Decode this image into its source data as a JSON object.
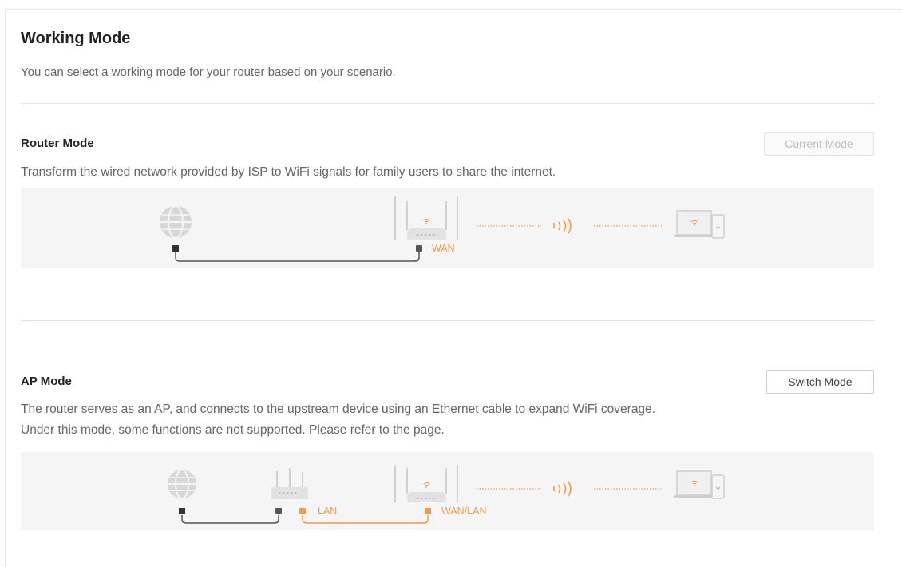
{
  "page": {
    "title": "Working Mode",
    "subtitle": "You can select a working mode for your router based on your scenario."
  },
  "router_mode": {
    "title": "Router Mode",
    "button_label": "Current Mode",
    "description": "Transform the wired network provided by ISP to WiFi signals for family users to share the internet.",
    "diagram": {
      "wan_label": "WAN",
      "icons": [
        "globe-icon",
        "router-icon",
        "wifi-signal-icon",
        "laptop-icon",
        "phone-icon"
      ]
    }
  },
  "ap_mode": {
    "title": "AP Mode",
    "button_label": "Switch Mode",
    "description_line1": "The router serves as an AP, and connects to the upstream device using an Ethernet cable to expand WiFi coverage.",
    "description_line2": "Under this mode, some functions are not supported. Please refer to the page.",
    "diagram": {
      "lan_label": "LAN",
      "wan_lan_label": "WAN/LAN",
      "icons": [
        "globe-icon",
        "upstream-router-icon",
        "router-icon",
        "wifi-signal-icon",
        "laptop-icon",
        "phone-icon"
      ]
    }
  },
  "colors": {
    "accent_orange": "#f39a4a",
    "cable_gray": "#555555",
    "diagram_background": "#f5f5f5",
    "disabled_text": "#bdbdbd"
  }
}
